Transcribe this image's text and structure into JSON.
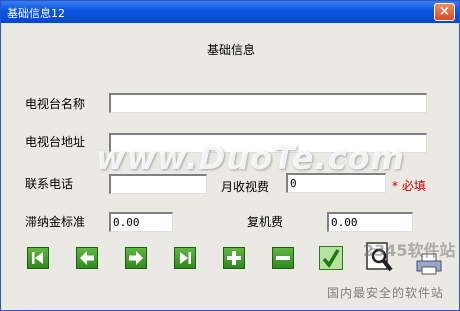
{
  "window": {
    "title": "基础信息12",
    "close_label": "×"
  },
  "form": {
    "heading": "基础信息",
    "station_name": {
      "label": "电视台名称",
      "value": ""
    },
    "station_address": {
      "label": "电视台地址",
      "value": ""
    },
    "contact_phone": {
      "label": "联系电话",
      "value": ""
    },
    "monthly_fee": {
      "label": "月收视费",
      "value": "0"
    },
    "required_note": "* 必填",
    "late_fee_rate": {
      "label": "滞纳金标准",
      "value": "0.00"
    },
    "restart_fee": {
      "label": "复机费",
      "value": "0.00"
    }
  },
  "toolbar": {
    "buttons": [
      {
        "name": "first-record-button",
        "icon": "first-record-icon"
      },
      {
        "name": "previous-record-button",
        "icon": "arrow-left-icon"
      },
      {
        "name": "next-record-button",
        "icon": "arrow-right-icon"
      },
      {
        "name": "last-record-button",
        "icon": "last-record-icon"
      },
      {
        "name": "add-record-button",
        "icon": "plus-icon"
      },
      {
        "name": "delete-record-button",
        "icon": "minus-icon"
      },
      {
        "name": "confirm-button",
        "icon": "checkmark-icon"
      },
      {
        "name": "preview-button",
        "icon": "magnifier-icon"
      },
      {
        "name": "print-button",
        "icon": "printer-icon"
      }
    ]
  },
  "watermark": {
    "text": "www.DuoTe.com",
    "brand_text": "2345软件站",
    "slogan": "国内最安全的软件站"
  },
  "colors": {
    "titlebar": "#0a55e0",
    "nav_green": "#3c9a28",
    "required_red": "#c00000",
    "window_bg": "#ebe9e4"
  }
}
